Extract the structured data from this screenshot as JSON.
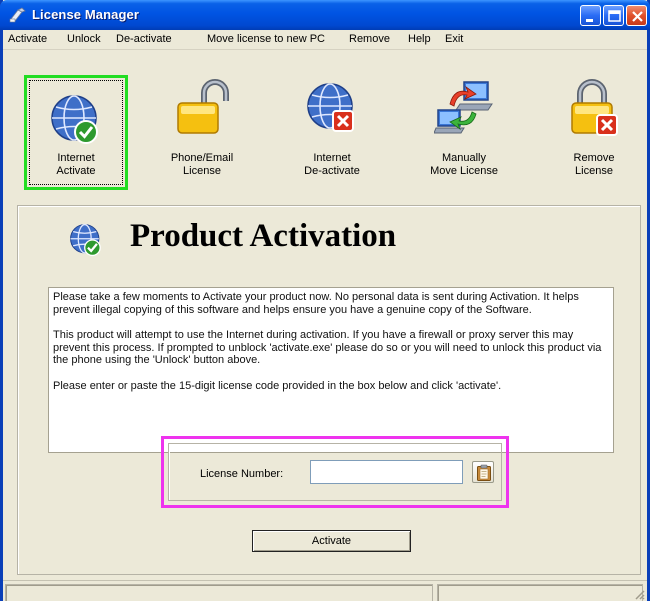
{
  "window": {
    "title": "License Manager"
  },
  "menu": [
    "Activate",
    "Unlock",
    "De-activate",
    "Move license to new PC",
    "Remove",
    "Help",
    "Exit"
  ],
  "toolbar": {
    "tools": [
      {
        "label": "Internet\nActivate",
        "icon": "globe-check-icon"
      },
      {
        "label": "Phone/Email\nLicense",
        "icon": "unlocked-padlock-icon"
      },
      {
        "label": "Internet\nDe-activate",
        "icon": "globe-x-icon"
      },
      {
        "label": "Manually\nMove License",
        "icon": "computers-transfer-icon"
      },
      {
        "label": "Remove\nLicense",
        "icon": "padlock-x-icon"
      }
    ]
  },
  "main": {
    "heading": "Product Activation",
    "paragraphs": [
      "Please take a few moments to Activate your product now.  No personal data is sent during Activation.  It helps prevent illegal copying of this software and helps ensure you have a genuine copy of the Software.",
      "This product will attempt to use the Internet during activation.  If you have a firewall or proxy server this may prevent this process.  If prompted to unblock 'activate.exe' please do so or you will need to unlock this product via the phone using the 'Unlock' button above.",
      "Please enter or paste the 15-digit license code provided in the box below and click 'activate'."
    ],
    "license_label": "License Number:",
    "license_value": "",
    "activate_label": "Activate"
  },
  "colors": {
    "highlight_green": "#22dd22",
    "highlight_magenta": "#ee33ee",
    "titlebar_blue": "#0054e3"
  }
}
